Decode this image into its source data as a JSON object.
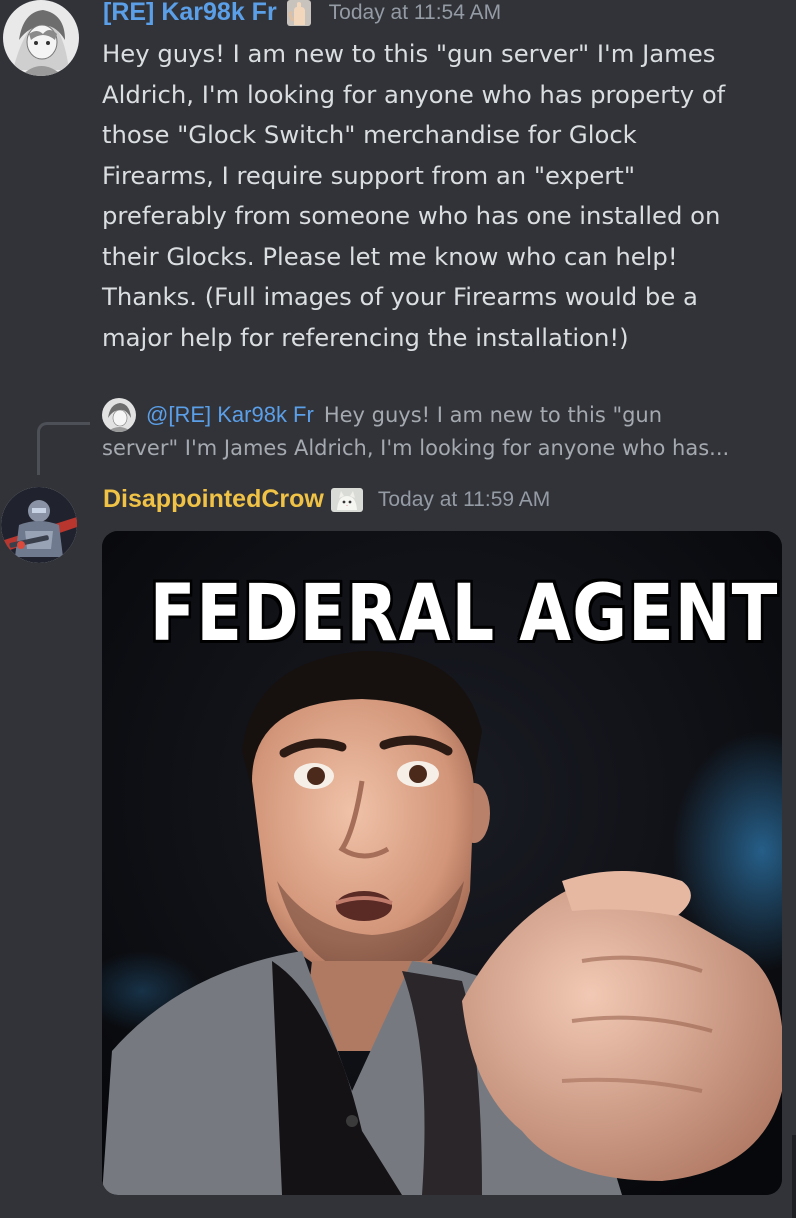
{
  "messages": [
    {
      "username": "[RE] Kar98k Fr",
      "username_color": "#5b9fe9",
      "tag_icon": "hand-icon",
      "timestamp": "Today at 11:54 AM",
      "avatar": "anime-character-avatar",
      "lines": [
        "Hey guys! I am new to this \"gun server\" I'm James",
        "Aldrich, I'm looking for anyone who has property of",
        "those \"Glock Switch\" merchandise for Glock",
        "Firearms, I require support from an \"expert\"",
        "preferably from someone who has one installed on",
        "their Glocks. Please let me know who can help!",
        "Thanks. (Full images of your Firearms would be a",
        "major help for referencing the installation!)"
      ]
    },
    {
      "reply": {
        "mention": "@[RE] Kar98k Fr",
        "preview_line1": "Hey guys! I am new to this \"gun",
        "preview_line2": "server\" I'm James Aldrich, I'm looking for anyone who has..."
      },
      "username": "DisappointedCrow",
      "username_color": "#f0c246",
      "tag_icon": "cat-icon",
      "timestamp": "Today at 11:59 AM",
      "avatar": "armored-soldier-avatar",
      "image": {
        "caption": "FEDERAL AGENT",
        "description_icon": "pointing-man-meme-image"
      }
    }
  ],
  "colors": {
    "background": "#313338",
    "text": "#dbdee1",
    "muted": "#949ba4"
  }
}
